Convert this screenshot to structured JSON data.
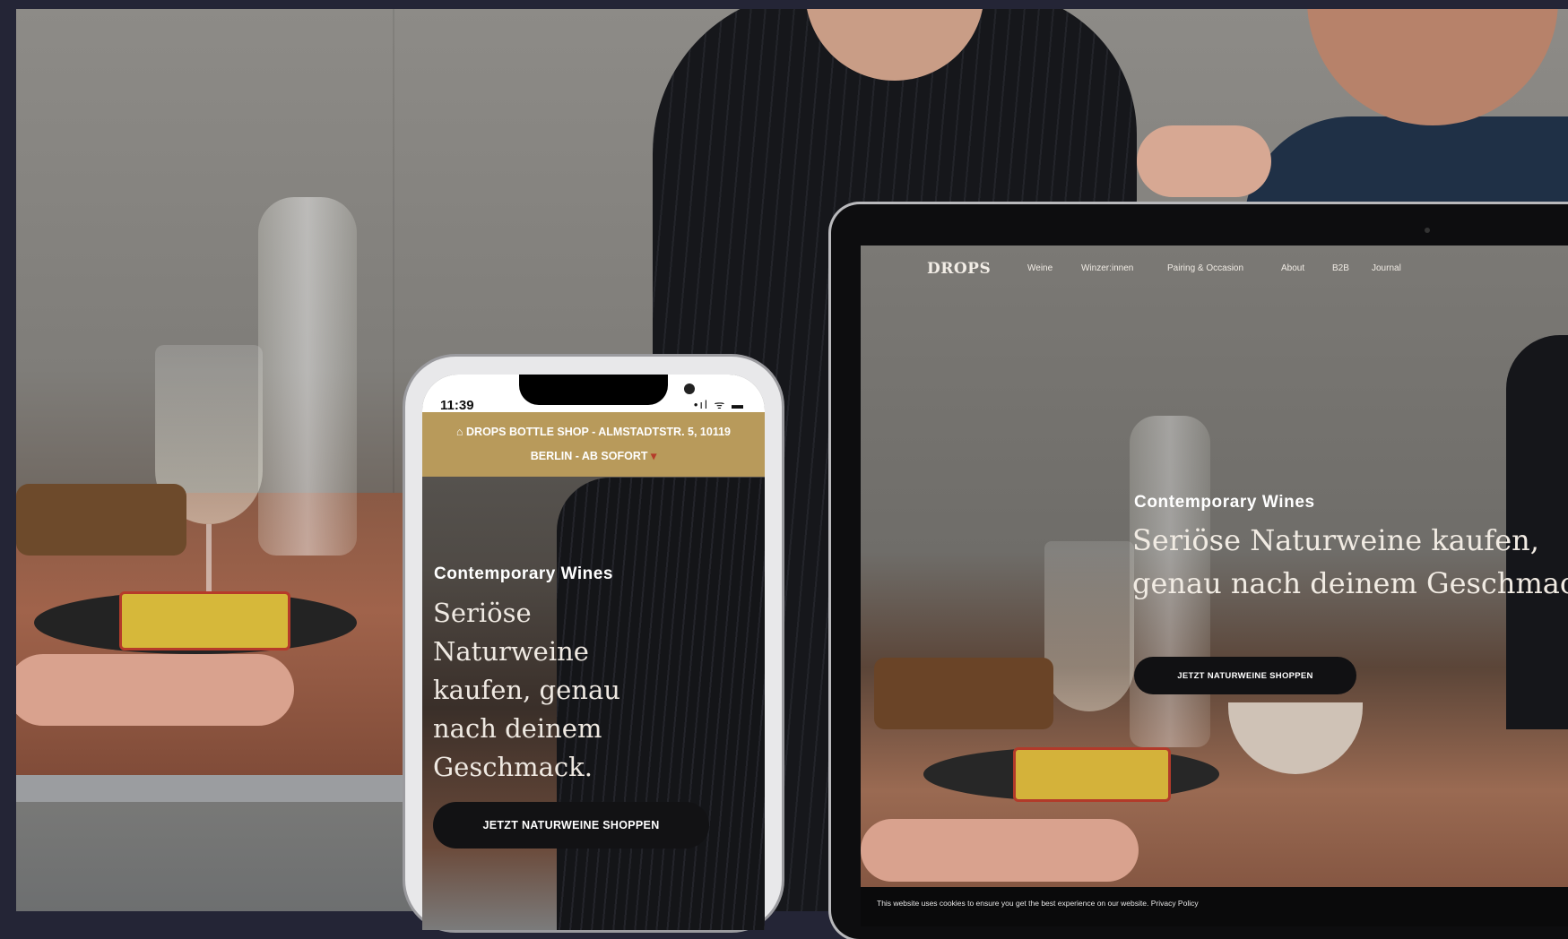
{
  "phone": {
    "status": {
      "time": "11:39",
      "signal": "•ıl ᯤ ▬"
    },
    "banner": {
      "icon": "shop-icon",
      "text": "DROPS BOTTLE SHOP - ALMSTADTSTR. 5, 10119 BERLIN - AB SOFORT"
    },
    "hero": {
      "eyebrow": "Contemporary Wines",
      "headline": "Seriöse Naturweine kaufen, genau nach deinem Geschmack.",
      "cta": "JETZT NATURWEINE SHOPPEN"
    }
  },
  "laptop": {
    "logo": "DROPS",
    "nav": [
      "Weine",
      "Winzer:innen",
      "Pairing & Occasion",
      "About",
      "B2B",
      "Journal"
    ],
    "hero": {
      "eyebrow": "Contemporary Wines",
      "headline": "Seriöse Naturweine kaufen, genau nach deinem Geschmack.",
      "cta": "JETZT NATURWEINE SHOPPEN"
    },
    "cookie": "This website uses cookies to ensure you get the best experience on our website. Privacy Policy"
  },
  "colors": {
    "page_background": "#242536",
    "banner": "#b89a5b",
    "button": "#121214"
  }
}
